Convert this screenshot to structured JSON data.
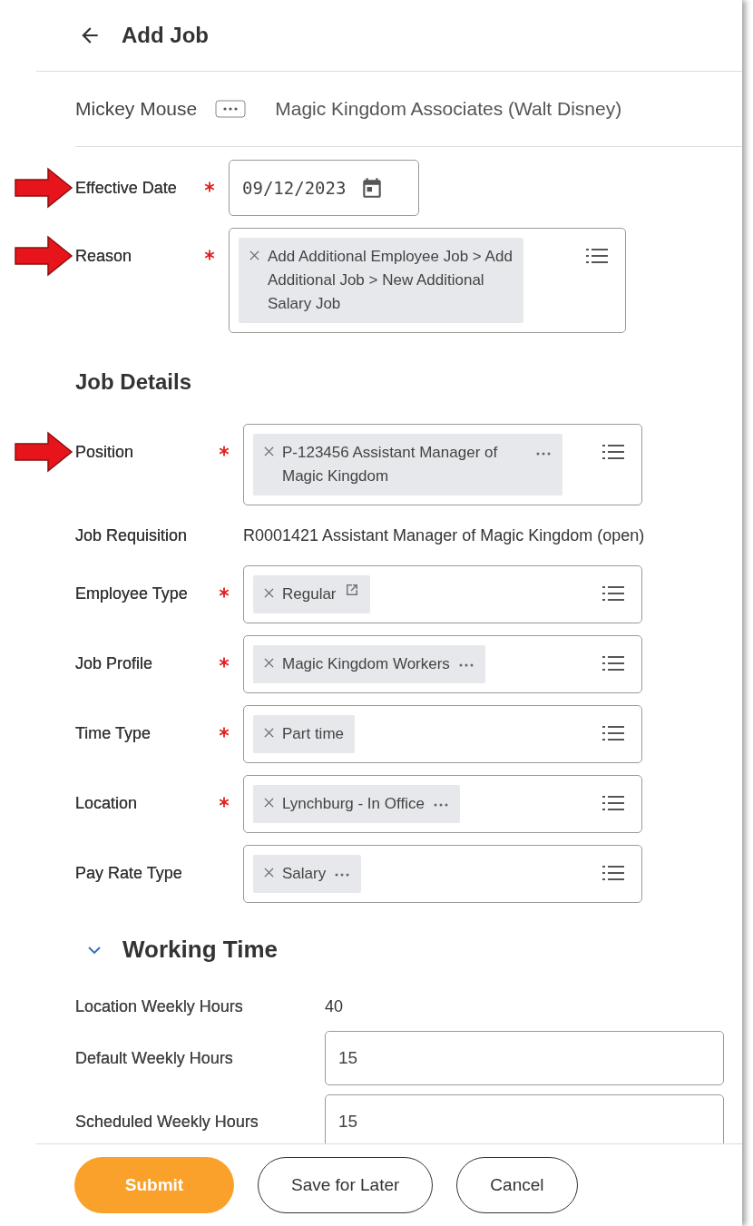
{
  "header": {
    "title": "Add Job"
  },
  "worker": {
    "name": "Mickey Mouse",
    "organization": "Magic Kingdom Associates (Walt Disney)"
  },
  "fields": [
    {
      "label": "Effective Date",
      "required": true,
      "annotated": true,
      "kind": "date",
      "value": "09/12/2023"
    },
    {
      "label": "Reason",
      "required": true,
      "annotated": true,
      "kind": "select",
      "chips": [
        {
          "text": "Add Additional Employee Job > Add Additional Job > New Additional Salary Job",
          "more": false,
          "link": false
        }
      ]
    }
  ],
  "job_details": {
    "heading": "Job Details",
    "fields": [
      {
        "label": "Position",
        "required": true,
        "annotated": true,
        "kind": "select",
        "chips": [
          {
            "text": "P-123456 Assistant Manager of Magic Kingdom",
            "more": true,
            "link": false
          }
        ]
      },
      {
        "label": "Job Requisition",
        "required": false,
        "annotated": false,
        "kind": "text",
        "value": "R0001421 Assistant Manager of Magic Kingdom (open)"
      },
      {
        "label": "Employee Type",
        "required": true,
        "annotated": false,
        "kind": "select",
        "chips": [
          {
            "text": "Regular",
            "more": false,
            "link": true
          }
        ]
      },
      {
        "label": "Job Profile",
        "required": true,
        "annotated": false,
        "kind": "select",
        "chips": [
          {
            "text": "Magic Kingdom Workers",
            "more": true,
            "link": false
          }
        ]
      },
      {
        "label": "Time Type",
        "required": true,
        "annotated": false,
        "kind": "select",
        "chips": [
          {
            "text": "Part time",
            "more": false,
            "link": false
          }
        ]
      },
      {
        "label": "Location",
        "required": true,
        "annotated": false,
        "kind": "select",
        "chips": [
          {
            "text": "Lynchburg - In Office",
            "more": true,
            "link": false
          }
        ]
      },
      {
        "label": "Pay Rate Type",
        "required": false,
        "annotated": false,
        "kind": "select",
        "chips": [
          {
            "text": "Salary",
            "more": true,
            "link": false
          }
        ]
      }
    ]
  },
  "working_time": {
    "heading": "Working Time",
    "expanded": true,
    "fields": [
      {
        "label": "Location Weekly Hours",
        "kind": "text",
        "value": "40"
      },
      {
        "label": "Default Weekly Hours",
        "kind": "input",
        "value": "15"
      },
      {
        "label": "Scheduled Weekly Hours",
        "kind": "input",
        "value": "15"
      }
    ]
  },
  "buttons": [
    {
      "label": "Submit",
      "kind": "primary"
    },
    {
      "label": "Save for Later",
      "kind": "secondary"
    },
    {
      "label": "Cancel",
      "kind": "secondary"
    }
  ]
}
